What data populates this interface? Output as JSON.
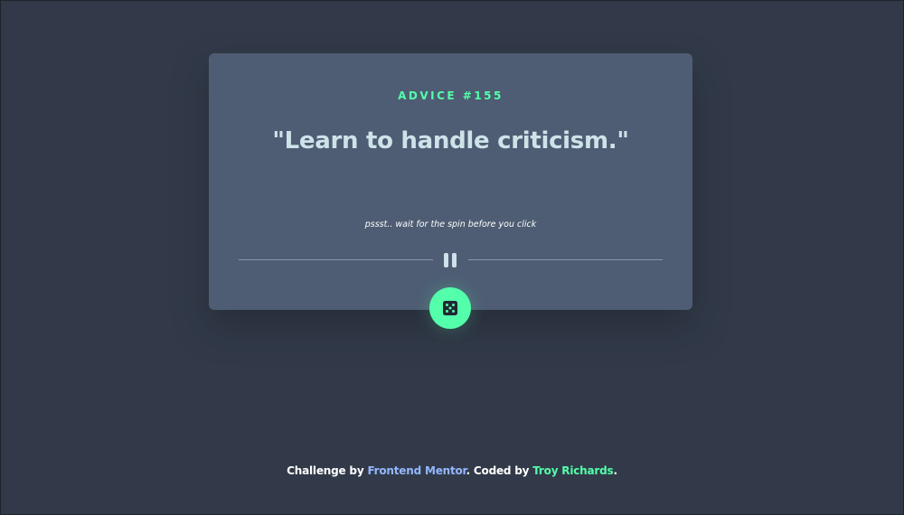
{
  "card": {
    "advice_id": "ADVICE #155",
    "advice_text": "\"Learn to handle criticism.\"",
    "hint": "pssst.. wait for the spin before you click"
  },
  "footer": {
    "prefix": "Challenge by ",
    "frontend_mentor": "Frontend Mentor",
    "middle": ". Coded by ",
    "author": "Troy Richards",
    "suffix": "."
  },
  "colors": {
    "background": "#323a49",
    "card": "#4e5d73",
    "accent_green": "#53ffaa",
    "link_blue": "#94b7ff",
    "text_light": "#cee3e9"
  },
  "icons": {
    "divider_center": "pause-icon",
    "button": "dice-icon"
  }
}
